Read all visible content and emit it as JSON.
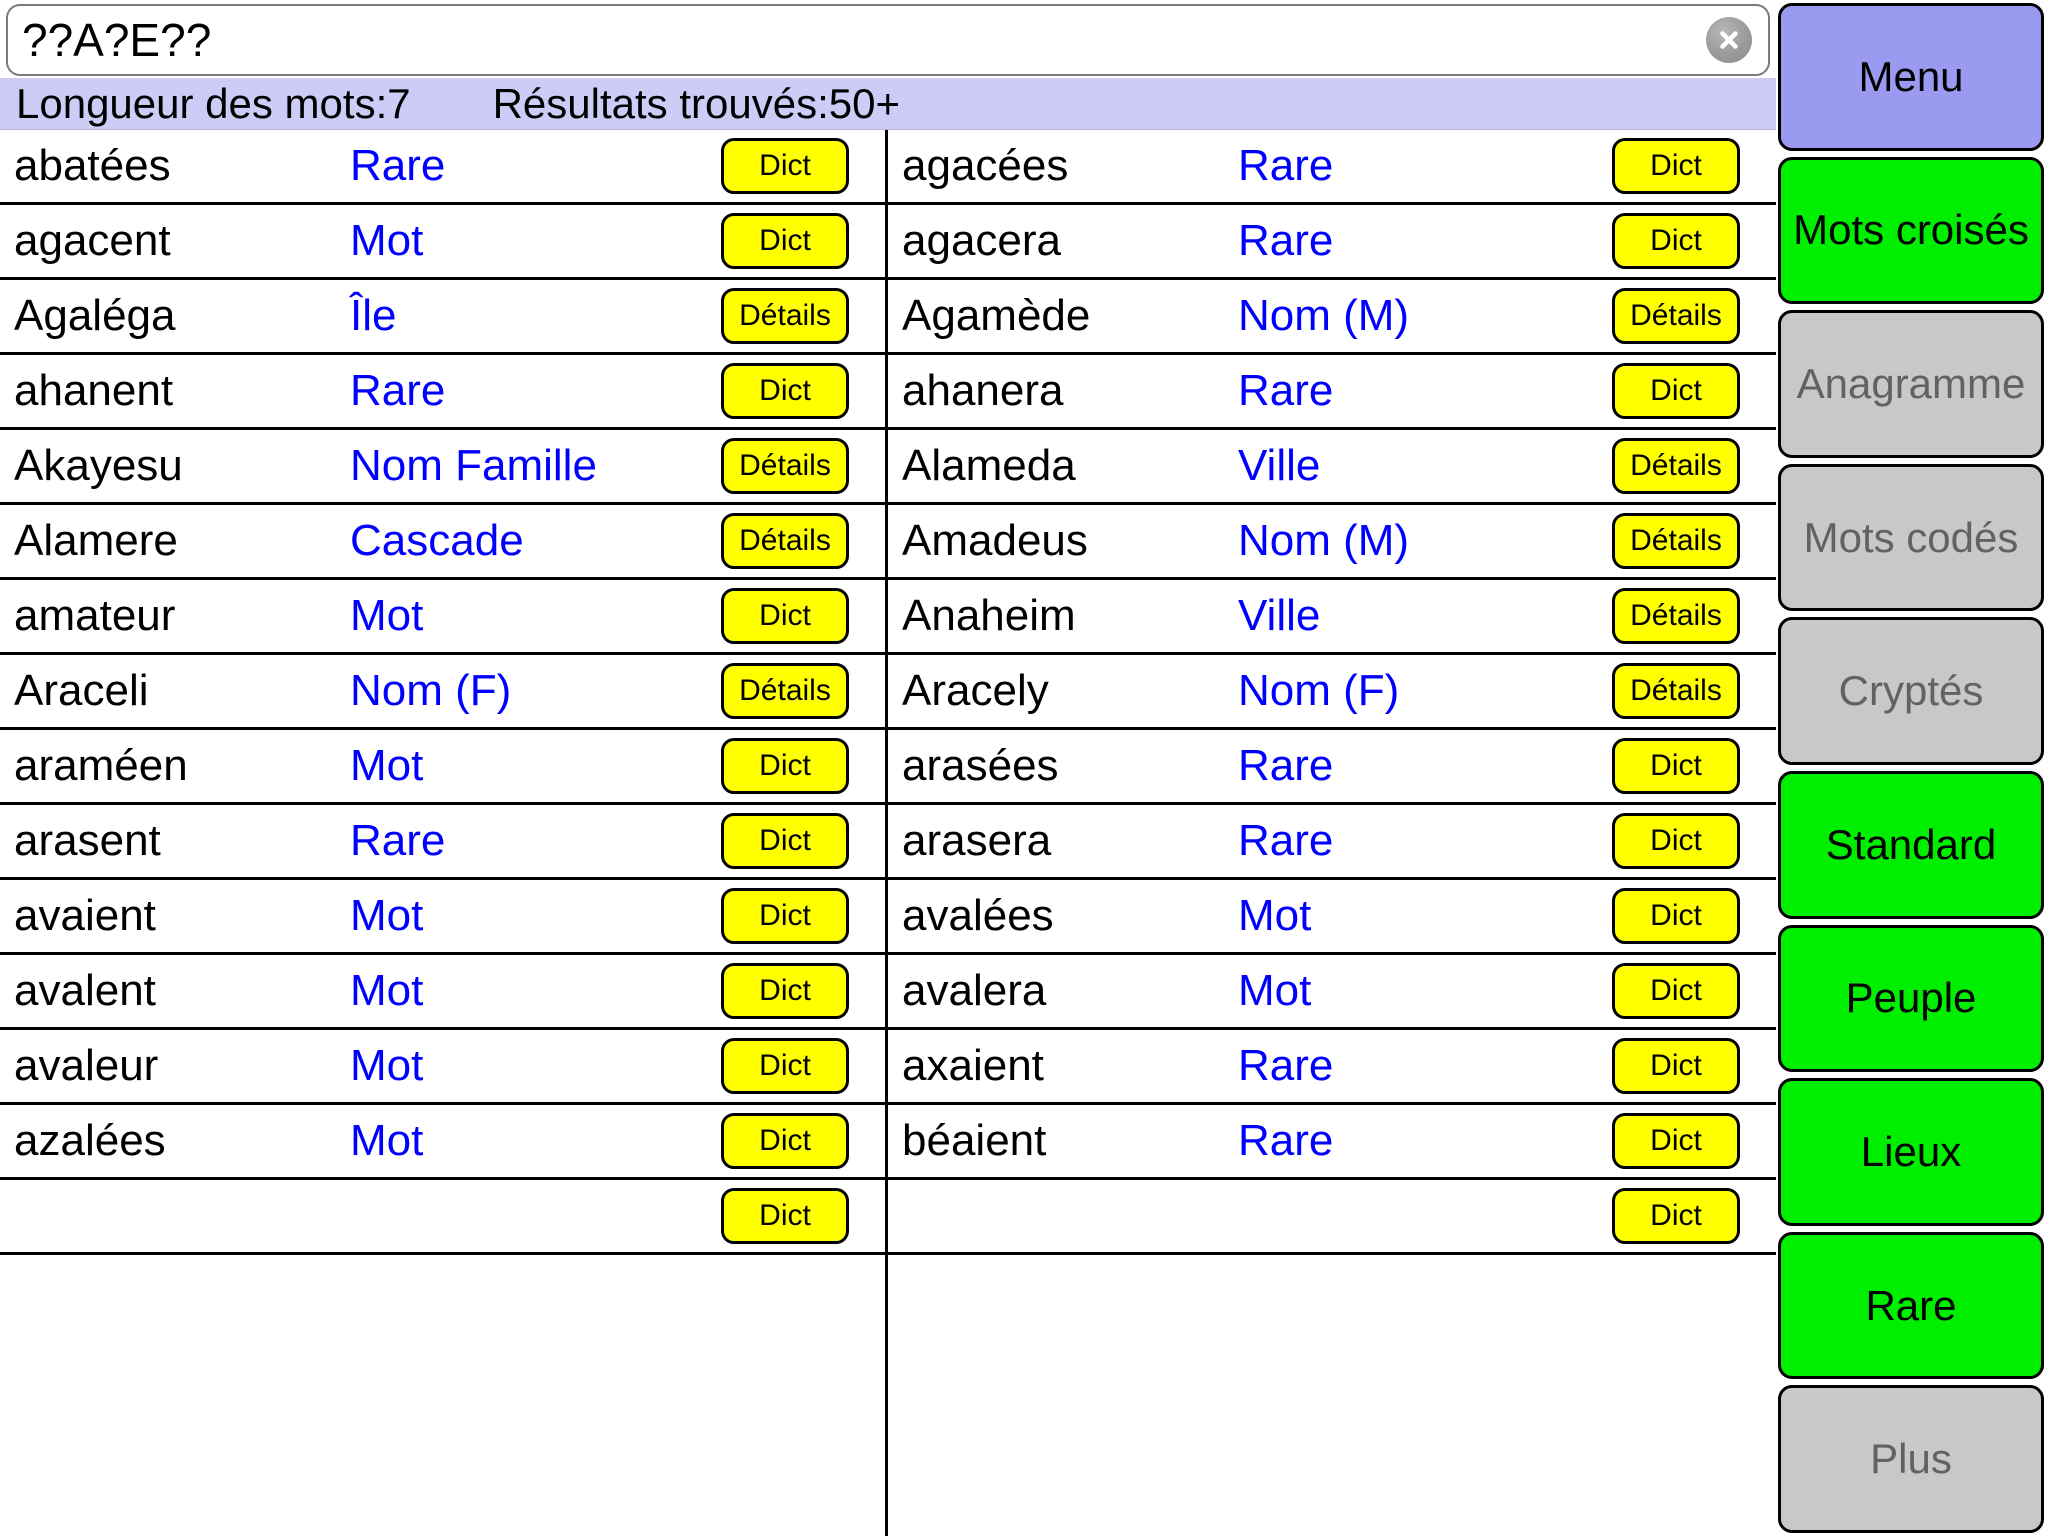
{
  "search": {
    "value": "??A?E??",
    "placeholder": "",
    "clear_label": "×"
  },
  "infobar": {
    "word_length": "Longueur des mots:7",
    "results_found": "Résultats trouvés:50+"
  },
  "colors": {
    "accent_blue": "#0000ff",
    "button_yellow": "#ffff00",
    "infobar_bg": "#ccccf7",
    "menu_purple": "#9a9af0",
    "active_green": "#00ee00",
    "disabled_gray": "#c8c8c8"
  },
  "results": {
    "left": [
      {
        "word": "abatées",
        "type": "Rare",
        "action": "Dict"
      },
      {
        "word": "agacent",
        "type": "Mot",
        "action": "Dict"
      },
      {
        "word": "Agaléga",
        "type": "Île",
        "action": "Détails"
      },
      {
        "word": "ahanent",
        "type": "Rare",
        "action": "Dict"
      },
      {
        "word": "Akayesu",
        "type": "Nom Famille",
        "action": "Détails"
      },
      {
        "word": "Alamere",
        "type": "Cascade",
        "action": "Détails"
      },
      {
        "word": "amateur",
        "type": "Mot",
        "action": "Dict"
      },
      {
        "word": "Araceli",
        "type": "Nom (F)",
        "action": "Détails"
      },
      {
        "word": "araméen",
        "type": "Mot",
        "action": "Dict"
      },
      {
        "word": "arasent",
        "type": "Rare",
        "action": "Dict"
      },
      {
        "word": "avaient",
        "type": "Mot",
        "action": "Dict"
      },
      {
        "word": "avalent",
        "type": "Mot",
        "action": "Dict"
      },
      {
        "word": "avaleur",
        "type": "Mot",
        "action": "Dict"
      },
      {
        "word": "azalées",
        "type": "Mot",
        "action": "Dict"
      },
      {
        "word": "",
        "type": "",
        "action": "Dict"
      }
    ],
    "right": [
      {
        "word": "agacées",
        "type": "Rare",
        "action": "Dict"
      },
      {
        "word": "agacera",
        "type": "Rare",
        "action": "Dict"
      },
      {
        "word": "Agamède",
        "type": "Nom (M)",
        "action": "Détails"
      },
      {
        "word": "ahanera",
        "type": "Rare",
        "action": "Dict"
      },
      {
        "word": "Alameda",
        "type": "Ville",
        "action": "Détails"
      },
      {
        "word": "Amadeus",
        "type": "Nom (M)",
        "action": "Détails"
      },
      {
        "word": "Anaheim",
        "type": "Ville",
        "action": "Détails"
      },
      {
        "word": "Aracely",
        "type": "Nom (F)",
        "action": "Détails"
      },
      {
        "word": "arasées",
        "type": "Rare",
        "action": "Dict"
      },
      {
        "word": "arasera",
        "type": "Rare",
        "action": "Dict"
      },
      {
        "word": "avalées",
        "type": "Mot",
        "action": "Dict"
      },
      {
        "word": "avalera",
        "type": "Mot",
        "action": "Dict"
      },
      {
        "word": "axaient",
        "type": "Rare",
        "action": "Dict"
      },
      {
        "word": "béaient",
        "type": "Rare",
        "action": "Dict"
      },
      {
        "word": "",
        "type": "",
        "action": "Dict"
      }
    ]
  },
  "sidebar": {
    "items": [
      {
        "label": "Menu",
        "state": "menu"
      },
      {
        "label": "Mots croisés",
        "state": "active"
      },
      {
        "label": "Anagramme",
        "state": "disabled"
      },
      {
        "label": "Mots codés",
        "state": "disabled"
      },
      {
        "label": "Cryptés",
        "state": "disabled"
      },
      {
        "label": "Standard",
        "state": "active"
      },
      {
        "label": "Peuple",
        "state": "active"
      },
      {
        "label": "Lieux",
        "state": "active"
      },
      {
        "label": "Rare",
        "state": "active"
      },
      {
        "label": "Plus",
        "state": "disabled"
      }
    ]
  }
}
